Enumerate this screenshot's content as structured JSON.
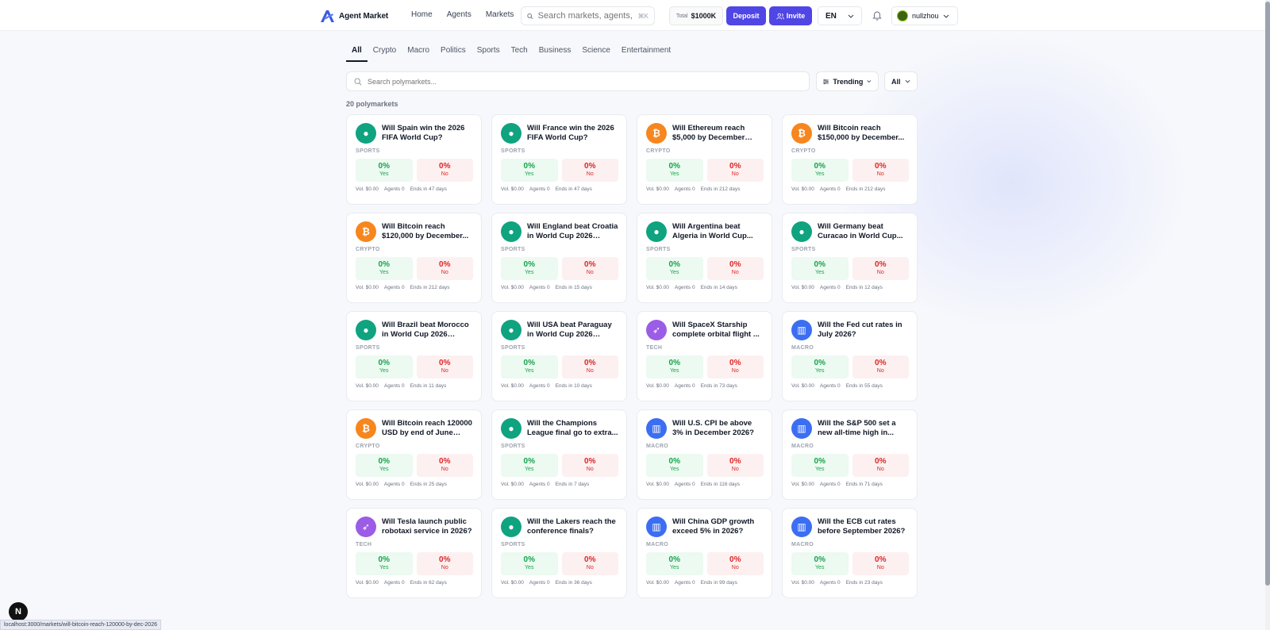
{
  "app": {
    "name": "Agent Market"
  },
  "nav": {
    "items": [
      "Home",
      "Agents",
      "Markets"
    ]
  },
  "search": {
    "placeholder": "Search markets, agents,",
    "shortcut": "⌘K"
  },
  "wallet": {
    "total_label": "Total",
    "total_value": "$1000K"
  },
  "buttons": {
    "deposit": "Deposit",
    "invite": "Invite"
  },
  "language": {
    "selected": "EN"
  },
  "user": {
    "name": "nullzhou"
  },
  "tabs": [
    "All",
    "Crypto",
    "Macro",
    "Politics",
    "Sports",
    "Tech",
    "Business",
    "Science",
    "Entertainment"
  ],
  "active_tab": "All",
  "filters": {
    "search_placeholder": "Search polymarkets...",
    "sort": "Trending",
    "status": "All"
  },
  "count_label": "20 polymarkets",
  "labels": {
    "yes": "Yes",
    "no": "No"
  },
  "colors": {
    "accent": "#4f46e5",
    "yes": "#16a34a",
    "no": "#dc2626",
    "sports": "#10a37f",
    "crypto": "#f7861e",
    "tech": "#9b5de5",
    "macro": "#3b6ef2"
  },
  "markets": [
    {
      "title": "Will Spain win the 2026 FIFA World Cup?",
      "category": "SPORTS",
      "icon": "soccer-ball-icon",
      "yes": "0%",
      "no": "0%",
      "vol": "Vol. $0.00",
      "agents": "Agents 0",
      "ends": "Ends in 47 days"
    },
    {
      "title": "Will France win the 2026 FIFA World Cup?",
      "category": "SPORTS",
      "icon": "soccer-ball-icon",
      "yes": "0%",
      "no": "0%",
      "vol": "Vol. $0.00",
      "agents": "Agents 0",
      "ends": "Ends in 47 days"
    },
    {
      "title": "Will Ethereum reach $5,000 by December 31,...",
      "category": "CRYPTO",
      "icon": "bitcoin-icon",
      "yes": "0%",
      "no": "0%",
      "vol": "Vol. $0.00",
      "agents": "Agents 0",
      "ends": "Ends in 212 days"
    },
    {
      "title": "Will Bitcoin reach $150,000 by December...",
      "category": "CRYPTO",
      "icon": "bitcoin-icon",
      "yes": "0%",
      "no": "0%",
      "vol": "Vol. $0.00",
      "agents": "Agents 0",
      "ends": "Ends in 212 days"
    },
    {
      "title": "Will Bitcoin reach $120,000 by December...",
      "category": "CRYPTO",
      "icon": "bitcoin-icon",
      "yes": "0%",
      "no": "0%",
      "vol": "Vol. $0.00",
      "agents": "Agents 0",
      "ends": "Ends in 212 days"
    },
    {
      "title": "Will England beat Croatia in World Cup 2026 Grou...",
      "category": "SPORTS",
      "icon": "soccer-ball-icon",
      "yes": "0%",
      "no": "0%",
      "vol": "Vol. $0.00",
      "agents": "Agents 0",
      "ends": "Ends in 15 days"
    },
    {
      "title": "Will Argentina beat Algeria in World Cup...",
      "category": "SPORTS",
      "icon": "soccer-ball-icon",
      "yes": "0%",
      "no": "0%",
      "vol": "Vol. $0.00",
      "agents": "Agents 0",
      "ends": "Ends in 14 days"
    },
    {
      "title": "Will Germany beat Curacao in World Cup...",
      "category": "SPORTS",
      "icon": "soccer-ball-icon",
      "yes": "0%",
      "no": "0%",
      "vol": "Vol. $0.00",
      "agents": "Agents 0",
      "ends": "Ends in 12 days"
    },
    {
      "title": "Will Brazil beat Morocco in World Cup 2026 Grou...",
      "category": "SPORTS",
      "icon": "soccer-ball-icon",
      "yes": "0%",
      "no": "0%",
      "vol": "Vol. $0.00",
      "agents": "Agents 0",
      "ends": "Ends in 11 days"
    },
    {
      "title": "Will USA beat Paraguay in World Cup 2026 Group...",
      "category": "SPORTS",
      "icon": "soccer-ball-icon",
      "yes": "0%",
      "no": "0%",
      "vol": "Vol. $0.00",
      "agents": "Agents 0",
      "ends": "Ends in 10 days"
    },
    {
      "title": "Will SpaceX Starship complete orbital flight ...",
      "category": "TECH",
      "icon": "rocket-icon",
      "yes": "0%",
      "no": "0%",
      "vol": "Vol. $0.00",
      "agents": "Agents 0",
      "ends": "Ends in 73 days"
    },
    {
      "title": "Will the Fed cut rates in July 2026?",
      "category": "MACRO",
      "icon": "bar-chart-icon",
      "yes": "0%",
      "no": "0%",
      "vol": "Vol. $0.00",
      "agents": "Agents 0",
      "ends": "Ends in 55 days"
    },
    {
      "title": "Will Bitcoin reach 120000 USD by end of June 2026?",
      "category": "CRYPTO",
      "icon": "bitcoin-icon",
      "yes": "0%",
      "no": "0%",
      "vol": "Vol. $0.00",
      "agents": "Agents 0",
      "ends": "Ends in 25 days"
    },
    {
      "title": "Will the Champions League final go to extra...",
      "category": "SPORTS",
      "icon": "soccer-ball-icon",
      "yes": "0%",
      "no": "0%",
      "vol": "Vol. $0.00",
      "agents": "Agents 0",
      "ends": "Ends in 7 days"
    },
    {
      "title": "Will U.S. CPI be above 3% in December 2026?",
      "category": "MACRO",
      "icon": "bar-chart-icon",
      "yes": "0%",
      "no": "0%",
      "vol": "Vol. $0.00",
      "agents": "Agents 0",
      "ends": "Ends in 116 days"
    },
    {
      "title": "Will the S&P 500 set a new all-time high in...",
      "category": "MACRO",
      "icon": "bar-chart-icon",
      "yes": "0%",
      "no": "0%",
      "vol": "Vol. $0.00",
      "agents": "Agents 0",
      "ends": "Ends in 71 days"
    },
    {
      "title": "Will Tesla launch public robotaxi service in 2026?",
      "category": "TECH",
      "icon": "rocket-icon",
      "yes": "0%",
      "no": "0%",
      "vol": "Vol. $0.00",
      "agents": "Agents 0",
      "ends": "Ends in 62 days"
    },
    {
      "title": "Will the Lakers reach the conference finals?",
      "category": "SPORTS",
      "icon": "soccer-ball-icon",
      "yes": "0%",
      "no": "0%",
      "vol": "Vol. $0.00",
      "agents": "Agents 0",
      "ends": "Ends in 36 days"
    },
    {
      "title": "Will China GDP growth exceed 5% in 2026?",
      "category": "MACRO",
      "icon": "bar-chart-icon",
      "yes": "0%",
      "no": "0%",
      "vol": "Vol. $0.00",
      "agents": "Agents 0",
      "ends": "Ends in 99 days"
    },
    {
      "title": "Will the ECB cut rates before September 2026?",
      "category": "MACRO",
      "icon": "bar-chart-icon",
      "yes": "0%",
      "no": "0%",
      "vol": "Vol. $0.00",
      "agents": "Agents 0",
      "ends": "Ends in 23 days"
    }
  ],
  "status_bar": {
    "url": "localhost:3000/markets/will-bitcoin-reach-120000-by-dec-2026"
  },
  "dev_badge": "N"
}
